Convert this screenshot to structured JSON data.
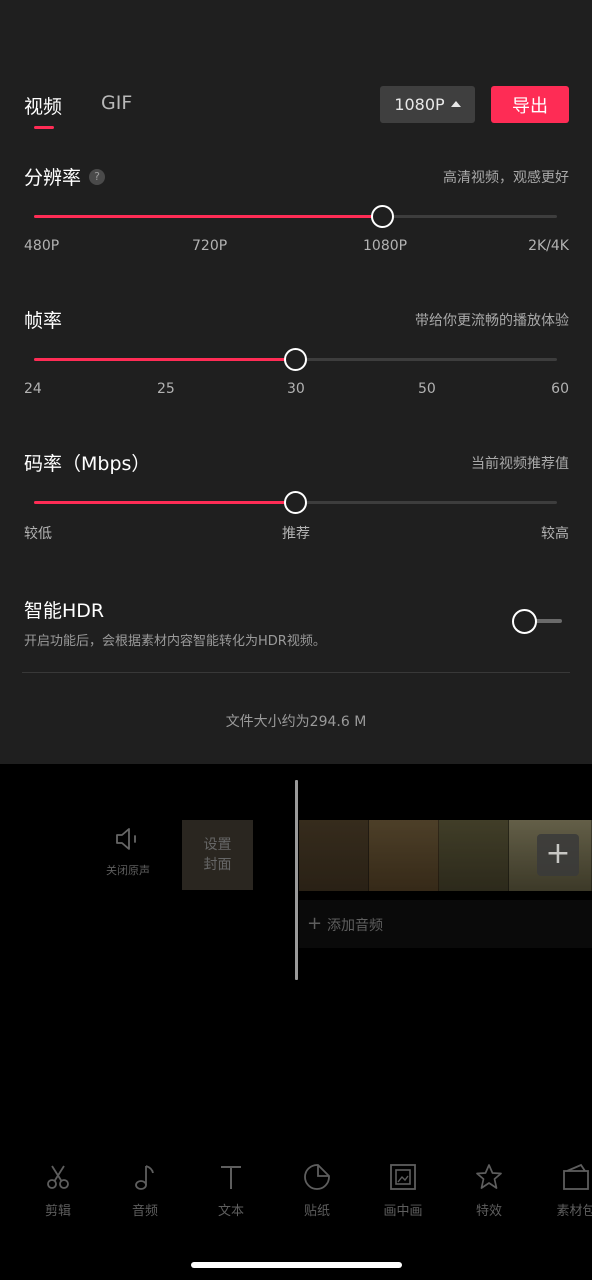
{
  "tabs": {
    "video": "视频",
    "gif": "GIF"
  },
  "resolution_selector": {
    "value": "1080P"
  },
  "export_button": {
    "label": "导出"
  },
  "resolution": {
    "title": "分辨率",
    "help": "?",
    "hint": "高清视频，观感更好",
    "ticks": [
      "480P",
      "720P",
      "1080P",
      "2K/4K"
    ],
    "selected": "1080P",
    "fill_fraction": 0.667
  },
  "frame_rate": {
    "title": "帧率",
    "hint": "带给你更流畅的播放体验",
    "ticks": [
      "24",
      "25",
      "30",
      "50",
      "60"
    ],
    "selected": "30",
    "fill_fraction": 0.5
  },
  "bitrate": {
    "title": "码率（Mbps）",
    "hint": "当前视频推荐值",
    "ticks": [
      "较低",
      "推荐",
      "较高"
    ],
    "selected": "推荐",
    "fill_fraction": 0.5
  },
  "smart_hdr": {
    "title": "智能HDR",
    "description": "开启功能后，会根据素材内容智能转化为HDR视频。",
    "enabled": false
  },
  "file_size": "文件大小约为294.6 M",
  "editor": {
    "mute_label": "关闭原声",
    "cover_label_line1": "设置",
    "cover_label_line2": "封面",
    "add_clip": "+",
    "add_audio": "添加音频"
  },
  "toolbar": [
    {
      "label": "剪辑",
      "icon": "scissors-icon"
    },
    {
      "label": "音频",
      "icon": "music-note-icon"
    },
    {
      "label": "文本",
      "icon": "text-icon"
    },
    {
      "label": "贴纸",
      "icon": "sticker-icon"
    },
    {
      "label": "画中画",
      "icon": "picture-in-picture-icon"
    },
    {
      "label": "特效",
      "icon": "effects-star-icon"
    },
    {
      "label": "素材包",
      "icon": "material-pack-icon"
    }
  ],
  "colors": {
    "accent": "#fe2c55",
    "sheet_bg": "#1f1f1f",
    "page_bg": "#000000"
  }
}
